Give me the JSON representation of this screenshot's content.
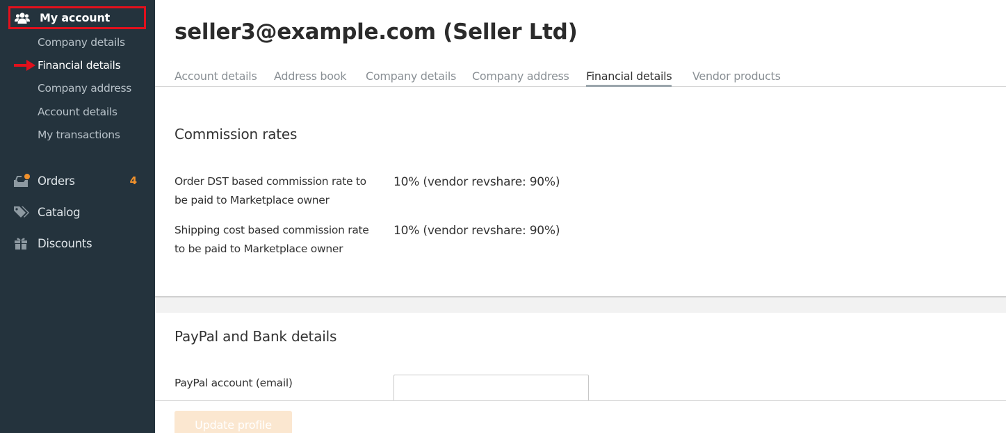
{
  "sidebar": {
    "header": {
      "label": "My account",
      "icon": "users-icon"
    },
    "sub_items": [
      {
        "label": "Company details"
      },
      {
        "label": "Financial details"
      },
      {
        "label": "Company address"
      },
      {
        "label": "Account details"
      },
      {
        "label": "My transactions"
      }
    ],
    "active_sub_item": "Financial details",
    "nav": [
      {
        "label": "Orders",
        "icon": "orders-inbox-icon",
        "badge": "4"
      },
      {
        "label": "Catalog",
        "icon": "tags-icon"
      },
      {
        "label": "Discounts",
        "icon": "gift-icon"
      }
    ]
  },
  "main": {
    "title": "seller3@example.com (Seller Ltd)",
    "tabs": [
      {
        "label": "Account details"
      },
      {
        "label": "Address book"
      },
      {
        "label": "Company details"
      },
      {
        "label": "Company address"
      },
      {
        "label": "Financial details"
      },
      {
        "label": "Vendor products"
      }
    ],
    "active_tab": "Financial details",
    "commission": {
      "title": "Commission rates",
      "rows": [
        {
          "label": "Order DST based commission rate to be paid to Marketplace owner",
          "value": "10% (vendor revshare: 90%)"
        },
        {
          "label": "Shipping cost based commission rate to be paid to Marketplace owner",
          "value": "10% (vendor revshare: 90%)"
        }
      ]
    },
    "paypal": {
      "title": "PayPal and Bank details",
      "account_label": "PayPal account (email)",
      "account_value": ""
    },
    "update_button": "Update profile"
  },
  "colors": {
    "sidebar_bg": "#24333d",
    "highlight_border": "#e2101c",
    "badge": "#f0912c",
    "button_bg": "#fbe7d0"
  }
}
